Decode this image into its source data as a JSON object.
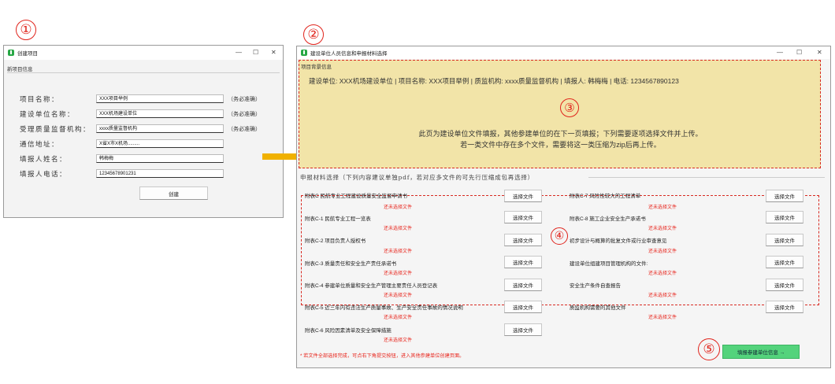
{
  "callouts": {
    "n1": "①",
    "n2": "②",
    "n3": "③",
    "n4": "④",
    "n5": "⑤"
  },
  "win1": {
    "title": "创建项目",
    "section": "新项目信息",
    "controls": {
      "min": "—",
      "max": "☐",
      "close": "✕"
    },
    "fields": [
      {
        "label": "项目名称：",
        "value": "XXX项目举例",
        "note": "（务必准确）"
      },
      {
        "label": "建设单位名称：",
        "value": "XXX机场建设单位",
        "note": "（务必准确）"
      },
      {
        "label": "受理质量监督机构：",
        "value": "xxxx质量监督机构",
        "note": "（务必准确）"
      },
      {
        "label": "通信地址：",
        "value": "X省X市X机场.........",
        "note": ""
      },
      {
        "label": "填报人姓名：",
        "value": "韩梅梅",
        "note": ""
      },
      {
        "label": "填报人电话：",
        "value": "12345678901231",
        "note": ""
      }
    ],
    "create_label": "创建"
  },
  "win2": {
    "title": "建设单位人员信息和申报材料选择",
    "controls": {
      "min": "—",
      "max": "☐",
      "close": "✕"
    },
    "bg_title": "项目背景信息",
    "info": "建设单位: XXX机场建设单位 | 项目名称: XXX项目举例 | 质监机构: xxxx质量监督机构 | 填报人: 韩梅梅 | 电话: 1234567890123",
    "notice1": "此页为建设单位文件填报，其他参建单位的在下一页填报；下列需要逐项选择文件并上传。",
    "notice2": "若一类文件中存在多个文件，需要将这一类压缩为zip后再上传。",
    "materials_title": "申报材料选择（下列内容建议单独pdf，若对应多文件的可先行压缩成包再选择）",
    "select_label": "选择文件",
    "status": "还未选择文件",
    "left_items": [
      "附表C 民航专业工程建设质量安全监督申请书",
      "附表C-1 民航专业工程一览表",
      "附表C-2 项目负责人授权书",
      "附表C-3 质量责任和安全生产责任承诺书",
      "附表C-4 参建单位质量和安全生产管理主要责任人员登记表",
      "附表C-5 近三年内有违法生产质量事故、生产安全责任事故的情况说明",
      "附表C-6 风险因素清单及安全保障措施"
    ],
    "right_items": [
      "附表C-7 风险性较大的工程清单",
      "附表C-8 施工企业安全生产承诺书",
      "初步设计与概算的批复文件或行业审查意见",
      "建设单位组建项目管理机构的文件:",
      "安全生产条件自查报告",
      "质监机构需要的其他文件"
    ],
    "footer_note": "* 若文件全部选择完成，可点右下角提交按钮，进入其他参建单位创建页面。",
    "next_label": "填报参建单位信息  →"
  },
  "colors": {
    "accent_red": "#e0231b",
    "arrow": "#f0b100",
    "panel": "#f2e4a8",
    "next_btn": "#54d37c"
  }
}
